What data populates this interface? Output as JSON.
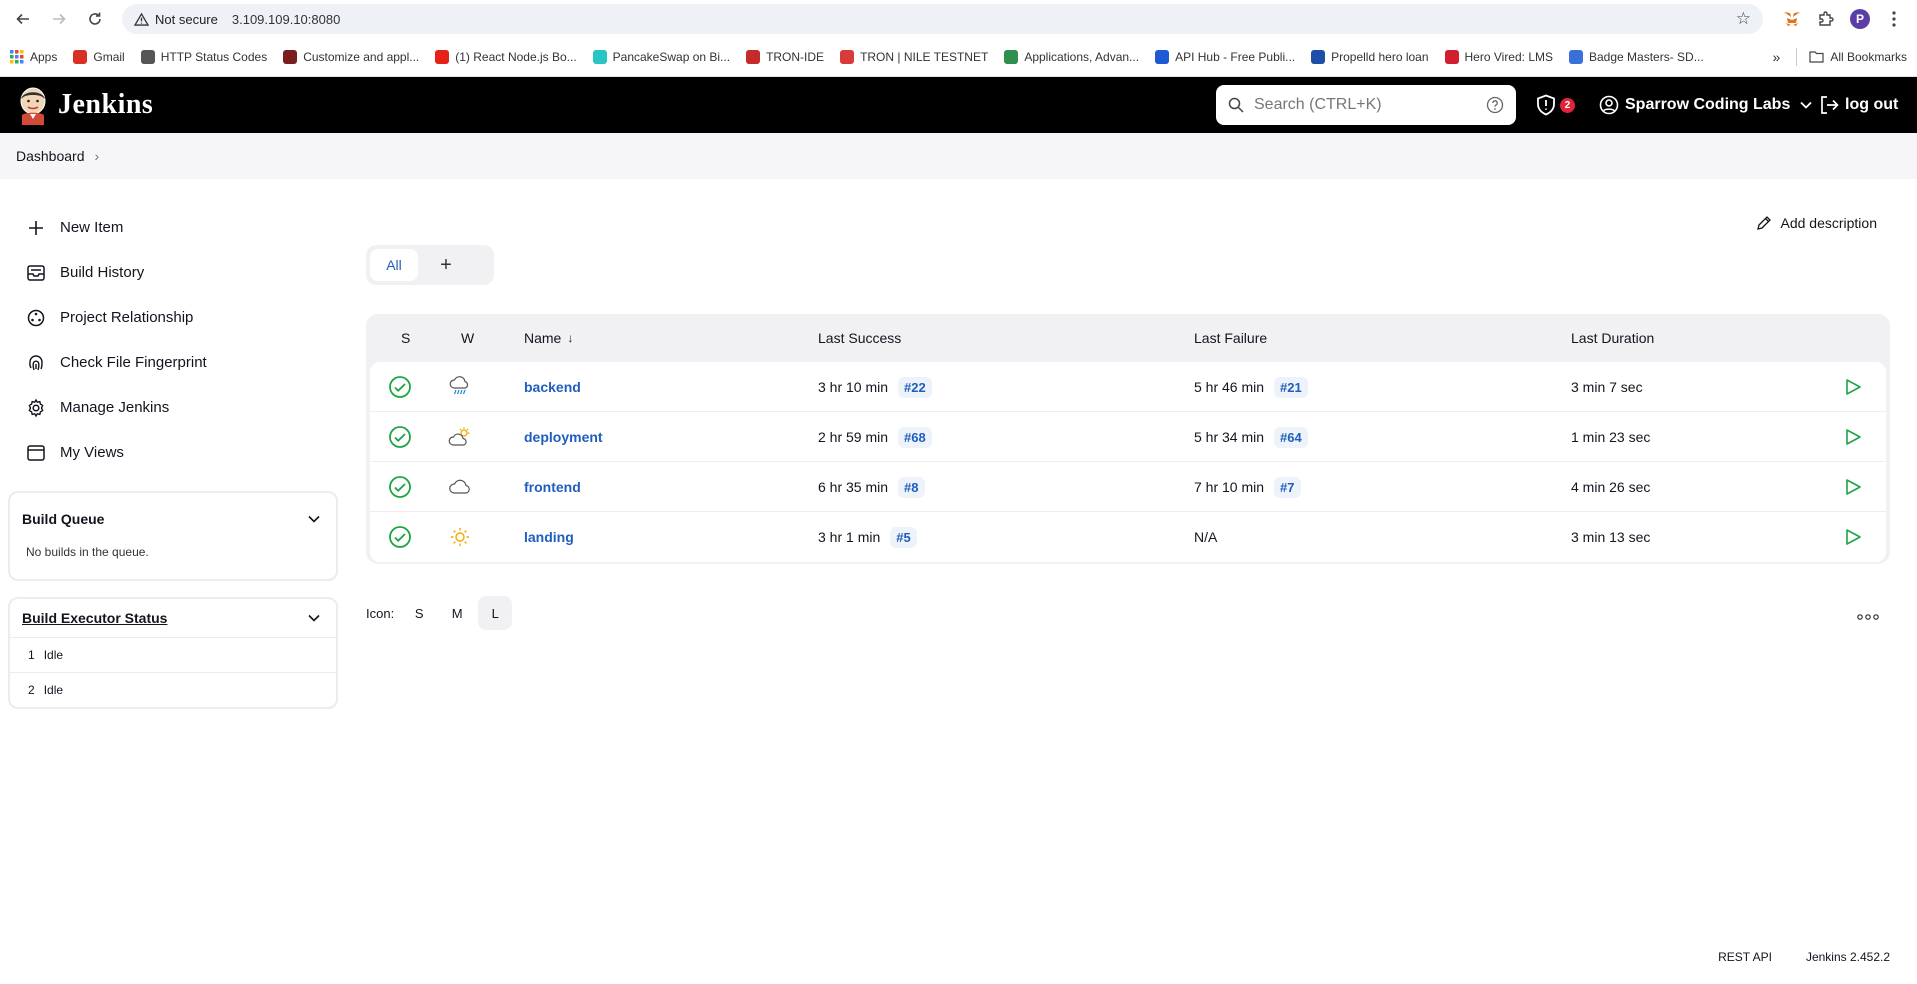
{
  "browser": {
    "security_label": "Not secure",
    "url": "3.109.109.10:8080",
    "profile_initial": "P",
    "bookmarks": [
      {
        "label": "Apps",
        "color": "#e8453c"
      },
      {
        "label": "Gmail",
        "color": "#d93025"
      },
      {
        "label": "HTTP Status Codes",
        "color": "#555555"
      },
      {
        "label": "Customize and appl...",
        "color": "#7a1f1f"
      },
      {
        "label": "(1) React Node.js Bo...",
        "color": "#e62117"
      },
      {
        "label": "PancakeSwap on Bi...",
        "color": "#29c5c5"
      },
      {
        "label": "TRON-IDE",
        "color": "#c62a2a"
      },
      {
        "label": "TRON | NILE TESTNET",
        "color": "#d93a3a"
      },
      {
        "label": "Applications, Advan...",
        "color": "#2f8f4e"
      },
      {
        "label": "API Hub - Free Publi...",
        "color": "#1e5ad6"
      },
      {
        "label": "Propelld hero loan",
        "color": "#1e4fa8"
      },
      {
        "label": "Hero Vired: LMS",
        "color": "#d11f2f"
      },
      {
        "label": "Badge Masters- SD...",
        "color": "#3b6fd9"
      }
    ],
    "all_bookmarks": "All Bookmarks"
  },
  "header": {
    "logo_text": "Jenkins",
    "search_placeholder": "Search (CTRL+K)",
    "security_count": "2",
    "user_name": "Sparrow Coding Labs",
    "logout": "log out"
  },
  "breadcrumb": {
    "dashboard": "Dashboard"
  },
  "sidebar": {
    "items": [
      {
        "label": "New Item"
      },
      {
        "label": "Build History"
      },
      {
        "label": "Project Relationship"
      },
      {
        "label": "Check File Fingerprint"
      },
      {
        "label": "Manage Jenkins"
      },
      {
        "label": "My Views"
      }
    ],
    "build_queue": {
      "title": "Build Queue",
      "empty": "No builds in the queue."
    },
    "executor": {
      "title": "Build Executor Status",
      "rows": [
        {
          "num": "1",
          "status": "Idle"
        },
        {
          "num": "2",
          "status": "Idle"
        }
      ]
    }
  },
  "main": {
    "add_description": "Add description",
    "tab_all": "All",
    "tab_add": "+",
    "columns": {
      "s": "S",
      "w": "W",
      "name": "Name",
      "name_sort": "↓",
      "last_success": "Last Success",
      "last_failure": "Last Failure",
      "last_duration": "Last Duration"
    },
    "jobs": [
      {
        "name": "backend",
        "weather": "rain",
        "success_time": "3 hr 10 min",
        "success_build": "#22",
        "failure_time": "5 hr 46 min",
        "failure_build": "#21",
        "duration": "3 min 7 sec"
      },
      {
        "name": "deployment",
        "weather": "partly-sunny",
        "success_time": "2 hr 59 min",
        "success_build": "#68",
        "failure_time": "5 hr 34 min",
        "failure_build": "#64",
        "duration": "1 min 23 sec"
      },
      {
        "name": "frontend",
        "weather": "cloud",
        "success_time": "6 hr 35 min",
        "success_build": "#8",
        "failure_time": "7 hr 10 min",
        "failure_build": "#7",
        "duration": "4 min 26 sec"
      },
      {
        "name": "landing",
        "weather": "sunny",
        "success_time": "3 hr 1 min",
        "success_build": "#5",
        "failure_time": "N/A",
        "failure_build": "",
        "duration": "3 min 13 sec"
      }
    ],
    "icon_label": "Icon:",
    "icon_sizes": [
      "S",
      "M",
      "L"
    ],
    "icon_active": "L"
  },
  "footer": {
    "rest_api": "REST API",
    "version": "Jenkins 2.452.2"
  },
  "colors": {
    "accent": "#1f5ebd",
    "success": "#1ea446",
    "header_bg": "#000000",
    "alert": "#e0243a"
  }
}
